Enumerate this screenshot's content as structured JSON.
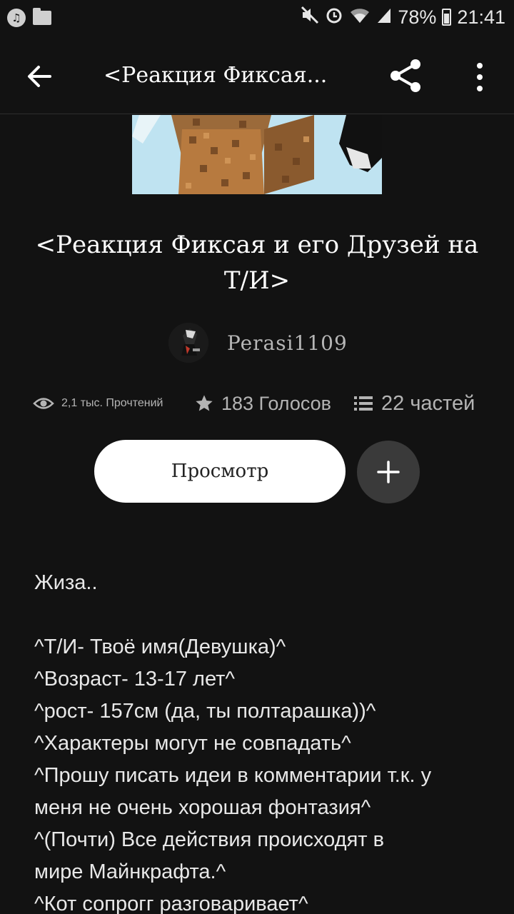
{
  "status_bar": {
    "battery": "78%",
    "time": "21:41",
    "icons": [
      "music-icon",
      "folder-icon",
      "mute-icon",
      "alarm-icon",
      "wifi-icon",
      "signal-icon",
      "battery-icon"
    ]
  },
  "toolbar": {
    "title": "<Реакция Фиксая..."
  },
  "story": {
    "title": "<Реакция Фиксая и его Друзей на Т/И>",
    "author": "Perasi1109",
    "stats": {
      "reads": "2,1 тыс. Прочтений",
      "votes": "183 Голосов",
      "parts": "22 частей"
    },
    "view_label": "Просмотр",
    "description_lines": [
      "Жиза..",
      "",
      "^Т/И- Твоё имя(Девушка)^",
      "^Возраст- 13-17 лет^",
      "^рост- 157см (да, ты полтарашка))^",
      "^Характеры могут не совпадать^",
      "^Прошу писать идеи в комментарии т.к. у",
      "меня не очень хорошая фонтазия^",
      "^(Почти) Все действия происходят в",
      "мире Майнкрафта.^",
      "^Кот сопрогг разговаривает^"
    ]
  },
  "colors": {
    "background": "#121212",
    "button_bg": "#ffffff",
    "add_bg": "#3a3a3a",
    "muted_text": "#b4b4b4"
  }
}
